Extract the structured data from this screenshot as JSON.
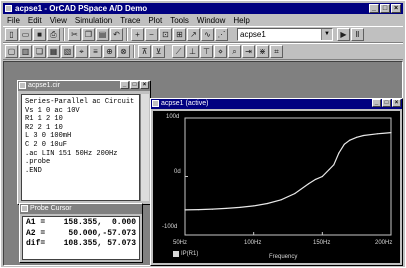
{
  "app": {
    "title": "acpse1 - OrCAD PSpace A/D Demo",
    "menu": [
      "File",
      "Edit",
      "View",
      "Simulation",
      "Trace",
      "Plot",
      "Tools",
      "Window",
      "Help"
    ],
    "sim_profile": "acpse1"
  },
  "netlist_window": {
    "title": "acpse1.cir",
    "lines": [
      "Series-Parallel ac Circuit",
      "Vs 1 0 ac 10V",
      "R1 1 2 10",
      "R2 2 1 10",
      "L 3 0 100mH",
      "C 2 0 10uF",
      ".ac LIN 151 50Hz 200Hz",
      ".probe",
      ".END"
    ]
  },
  "cursor_window": {
    "title": "Probe Cursor",
    "rows": [
      {
        "label": "A1 =",
        "v1": "158.355,",
        "v2": "0.000"
      },
      {
        "label": "A2 =",
        "v1": "50.000,",
        "v2": "-57.073"
      },
      {
        "label": "dif=",
        "v1": "108.355,",
        "v2": "57.073"
      }
    ]
  },
  "probe_window": {
    "title": "acpse1 (active)",
    "y_ticks": [
      "100d",
      "0d",
      "-100d"
    ],
    "x_ticks": [
      "50Hz",
      "100Hz",
      "150Hz",
      "200Hz"
    ],
    "xlabel": "Frequency",
    "legend": "IP(R1)"
  },
  "chart_data": {
    "type": "line",
    "xlabel": "Frequency",
    "ylabel": "",
    "xlim": [
      50,
      200
    ],
    "ylim": [
      -100,
      100
    ],
    "series": [
      {
        "name": "IP(R1)",
        "x": [
          50,
          60,
          70,
          80,
          90,
          100,
          110,
          120,
          130,
          140,
          145,
          150,
          155,
          158.355,
          162,
          166,
          170,
          175,
          180,
          190,
          200
        ],
        "y": [
          -57.1,
          -56.6,
          -55.8,
          -54.6,
          -52.8,
          -50.2,
          -46.2,
          -39.8,
          -29.0,
          -12.5,
          -5.0,
          0.0,
          12.0,
          20.0,
          40.0,
          55.0,
          62.0,
          67.0,
          70.0,
          73.0,
          75.0
        ]
      }
    ]
  }
}
